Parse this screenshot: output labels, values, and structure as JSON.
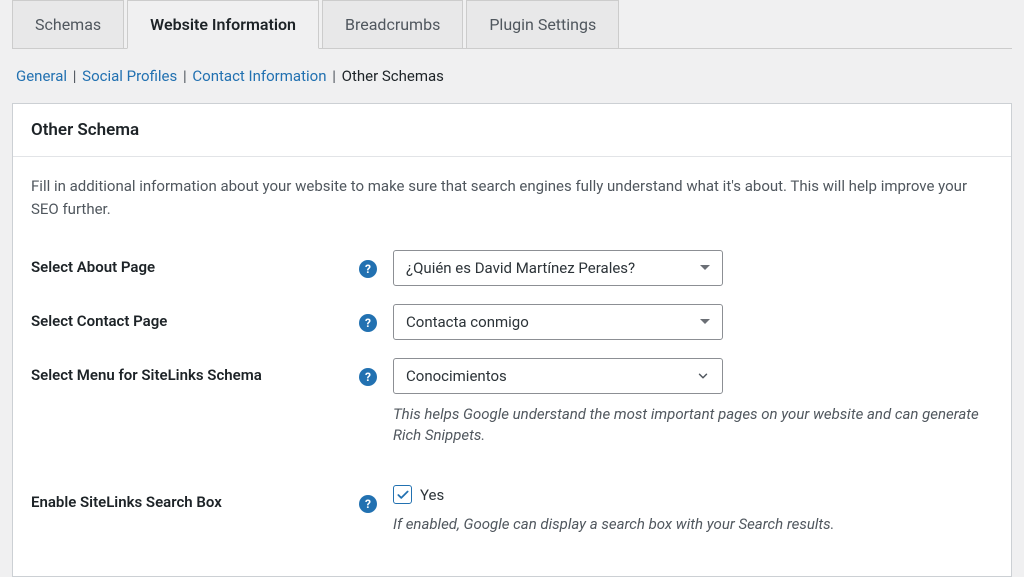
{
  "tabs": {
    "schemas": "Schemas",
    "website_info": "Website Information",
    "breadcrumbs": "Breadcrumbs",
    "plugin_settings": "Plugin Settings"
  },
  "subtabs": {
    "general": "General",
    "social": "Social Profiles",
    "contact": "Contact Information",
    "other": "Other Schemas"
  },
  "panel": {
    "title": "Other Schema",
    "description": "Fill in additional information about your website to make sure that search engines fully understand what it's about. This will help improve your SEO further."
  },
  "fields": {
    "about": {
      "label": "Select About Page",
      "value": "¿Quién es David Martínez Perales?"
    },
    "contact": {
      "label": "Select Contact Page",
      "value": "Contacta conmigo"
    },
    "menu": {
      "label": "Select Menu for SiteLinks Schema",
      "value": "Conocimientos",
      "helper": "This helps Google understand the most important pages on your website and can generate Rich Snippets."
    },
    "searchbox": {
      "label": "Enable SiteLinks Search Box",
      "checkbox_label": "Yes",
      "helper": "If enabled, Google can display a search box with your Search results."
    }
  }
}
